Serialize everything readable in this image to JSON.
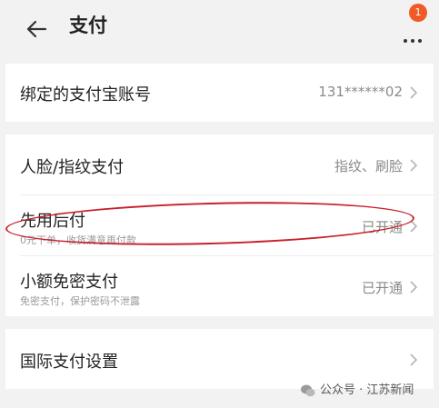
{
  "header": {
    "title": "支付",
    "notification_count": "1"
  },
  "sections": [
    {
      "rows": [
        {
          "label": "绑定的支付宝账号",
          "value": "131******02"
        }
      ]
    },
    {
      "rows": [
        {
          "label": "人脸/指纹支付",
          "value": "指纹、刷脸"
        },
        {
          "label": "先用后付",
          "sub": "0元下单，收货满意再付款",
          "value": "已开通"
        },
        {
          "label": "小额免密支付",
          "sub": "免密支付，保护密码不泄露",
          "value": "已开通"
        }
      ]
    },
    {
      "rows": [
        {
          "label": "国际支付设置"
        }
      ]
    }
  ],
  "watermark": {
    "text": "公众号 · 江苏新闻"
  },
  "colors": {
    "accent": "#f05a24",
    "highlight": "#c8202a",
    "background": "#f2f2f2"
  }
}
